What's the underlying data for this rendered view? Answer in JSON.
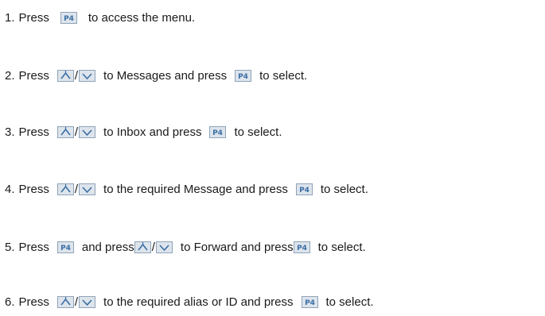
{
  "steps": [
    {
      "number": "1.",
      "parts": [
        "Press",
        "to access the menu."
      ]
    },
    {
      "number": "2.",
      "parts": [
        "Press",
        "/",
        "to Messages and press",
        "to select."
      ]
    },
    {
      "number": "3.",
      "parts": [
        "Press",
        "/",
        "to Inbox and press",
        "to select."
      ]
    },
    {
      "number": "4.",
      "parts": [
        "Press",
        "/",
        "to the required Message and press",
        "to select."
      ]
    },
    {
      "number": "5.",
      "parts": [
        "Press",
        "and press",
        "/",
        "to Forward and press",
        "to select."
      ]
    },
    {
      "number": "6.",
      "parts": [
        "Press",
        "/",
        "to the required alias or ID and press",
        "to select."
      ]
    }
  ],
  "keys": {
    "menu_key_label": "P4",
    "menu_key_icon": "menu-select-key-icon",
    "up_key_icon": "nav-up-key-icon",
    "down_key_icon": "nav-down-key-icon"
  },
  "colors": {
    "key_fill": "#dde4ec",
    "key_border": "#8fa3b8",
    "key_text": "#3a6ea5"
  }
}
